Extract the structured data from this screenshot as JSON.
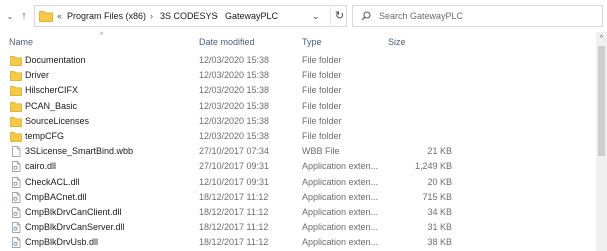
{
  "address_bar": {
    "overflow_label": "«",
    "path": [
      "Program Files (x86)",
      "3S CODESYS",
      "GatewayPLC"
    ],
    "separator": "›"
  },
  "search": {
    "placeholder": "Search GatewayPLC"
  },
  "columns": {
    "name": "Name",
    "date": "Date modified",
    "type": "Type",
    "size": "Size"
  },
  "files": [
    {
      "name": "Documentation",
      "date": "12/03/2020 15:38",
      "type": "File folder",
      "size": "",
      "icon": "folder-icon"
    },
    {
      "name": "Driver",
      "date": "12/03/2020 15:38",
      "type": "File folder",
      "size": "",
      "icon": "folder-icon"
    },
    {
      "name": "HilscherCIFX",
      "date": "12/03/2020 15:38",
      "type": "File folder",
      "size": "",
      "icon": "folder-icon"
    },
    {
      "name": "PCAN_Basic",
      "date": "12/03/2020 15:38",
      "type": "File folder",
      "size": "",
      "icon": "folder-icon"
    },
    {
      "name": "SourceLicenses",
      "date": "12/03/2020 15:38",
      "type": "File folder",
      "size": "",
      "icon": "folder-icon"
    },
    {
      "name": "tempCFG",
      "date": "12/03/2020 15:38",
      "type": "File folder",
      "size": "",
      "icon": "folder-icon"
    },
    {
      "name": "3SLicense_SmartBind.wbb",
      "date": "27/10/2017 07:34",
      "type": "WBB File",
      "size": "21 KB",
      "icon": "file-icon"
    },
    {
      "name": "cairo.dll",
      "date": "27/10/2017 09:31",
      "type": "Application exten...",
      "size": "1,249 KB",
      "icon": "dll-file-icon"
    },
    {
      "name": "CheckACL.dll",
      "date": "12/10/2017 09:31",
      "type": "Application exten...",
      "size": "20 KB",
      "icon": "dll-file-icon"
    },
    {
      "name": "CmpBACnet.dll",
      "date": "18/12/2017 11:12",
      "type": "Application exten...",
      "size": "715 KB",
      "icon": "dll-file-icon"
    },
    {
      "name": "CmpBlkDrvCanClient.dll",
      "date": "18/12/2017 11:12",
      "type": "Application exten...",
      "size": "34 KB",
      "icon": "dll-file-icon"
    },
    {
      "name": "CmpBlkDrvCanServer.dll",
      "date": "18/12/2017 11:12",
      "type": "Application exten...",
      "size": "31 KB",
      "icon": "dll-file-icon"
    },
    {
      "name": "CmpBlkDrvUsb.dll",
      "date": "18/12/2017 11:12",
      "type": "Application exten...",
      "size": "38 KB",
      "icon": "dll-file-icon"
    }
  ],
  "colors": {
    "folder": "#f7c948",
    "header_text": "#4c607a",
    "muted_text": "#6d6d6d"
  }
}
